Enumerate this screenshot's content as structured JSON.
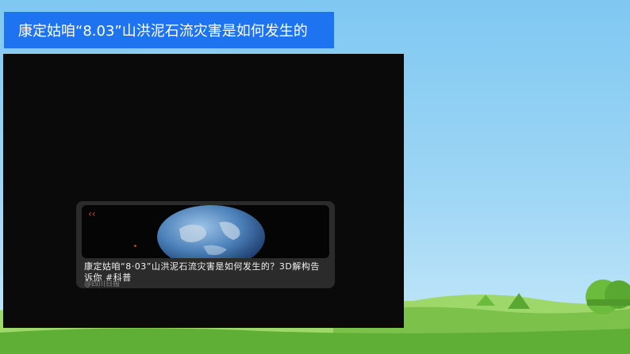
{
  "slide": {
    "title": "康定姑咱“8.03”山洪泥石流灾害是如何发生的"
  },
  "video": {
    "caption": "康定姑咱“8·03”山洪泥石流灾害是如何发生的？3D解构告诉你 #科普",
    "source": "@四川日报"
  },
  "icons": {
    "back": "back-chevron-icon",
    "globe": "earth-globe-icon"
  },
  "colors": {
    "title_bar": "#1e74f0",
    "video_bg": "#0a0a0a",
    "card_bg": "#2b2b2b",
    "accent_red": "#e23b2e"
  }
}
